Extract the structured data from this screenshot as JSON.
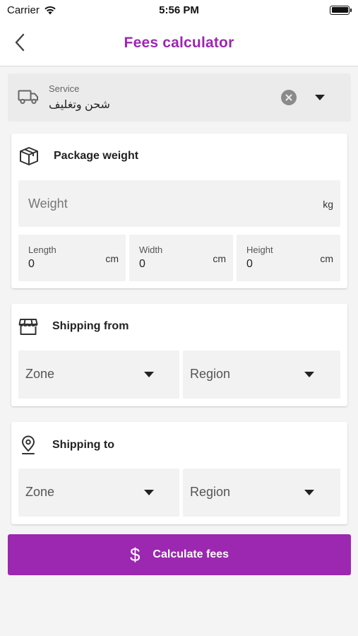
{
  "status_bar": {
    "carrier": "Carrier",
    "time": "5:56 PM"
  },
  "header": {
    "title": "Fees calculator"
  },
  "service": {
    "label": "Service",
    "value": "شحن وتغليف"
  },
  "package_weight": {
    "title": "Package weight",
    "weight_placeholder": "Weight",
    "weight_unit": "kg",
    "length": {
      "label": "Length",
      "value": "0",
      "unit": "cm"
    },
    "width": {
      "label": "Width",
      "value": "0",
      "unit": "cm"
    },
    "height": {
      "label": "Height",
      "value": "0",
      "unit": "cm"
    }
  },
  "shipping_from": {
    "title": "Shipping from",
    "zone_placeholder": "Zone",
    "region_placeholder": "Region"
  },
  "shipping_to": {
    "title": "Shipping to",
    "zone_placeholder": "Zone",
    "region_placeholder": "Region"
  },
  "calculate_button": {
    "icon": "$",
    "label": "Calculate fees"
  },
  "colors": {
    "accent": "#9c27b0",
    "field_bg": "#f2f2f2",
    "page_bg": "#f4f4f4"
  }
}
